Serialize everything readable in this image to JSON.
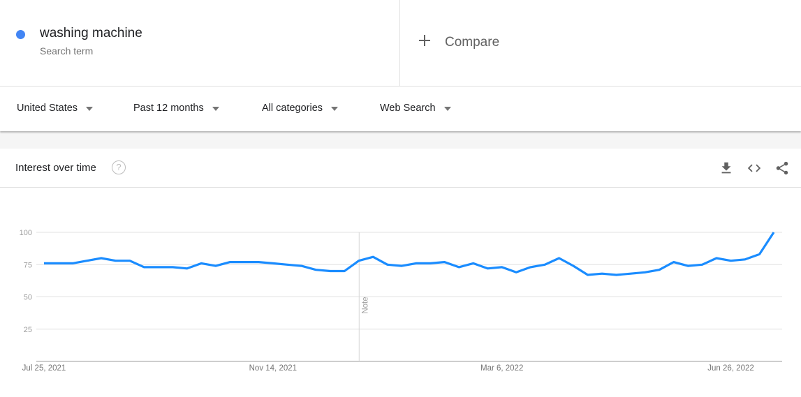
{
  "search_term": {
    "name": "washing machine",
    "type_label": "Search term",
    "color": "#4285f4"
  },
  "compare": {
    "icon": "plus-icon",
    "label": "Compare"
  },
  "filters": [
    {
      "label": "United States",
      "icon": "caret-down-icon"
    },
    {
      "label": "Past 12 months",
      "icon": "caret-down-icon"
    },
    {
      "label": "All categories",
      "icon": "caret-down-icon"
    },
    {
      "label": "Web Search",
      "icon": "caret-down-icon"
    }
  ],
  "card": {
    "title": "Interest over time",
    "help_icon": "help-circle-icon",
    "help_glyph": "?",
    "actions": [
      {
        "name": "download-icon"
      },
      {
        "name": "embed-code-icon"
      },
      {
        "name": "share-icon"
      }
    ]
  },
  "chart_data": {
    "type": "line",
    "title": "Interest over time",
    "xlabel": "",
    "ylabel": "",
    "ylim": [
      0,
      100
    ],
    "yticks": [
      25,
      50,
      75,
      100
    ],
    "grid": true,
    "x_tick_labels": [
      {
        "label": "Jul 25, 2021",
        "index": 0
      },
      {
        "label": "Nov 14, 2021",
        "index": 16
      },
      {
        "label": "Mar 6, 2022",
        "index": 32
      },
      {
        "label": "Jun 26, 2022",
        "index": 48
      }
    ],
    "annotations": [
      {
        "label": "Note",
        "index": 22
      }
    ],
    "series": [
      {
        "name": "washing machine",
        "color": "#1a8cff",
        "values": [
          76,
          76,
          76,
          78,
          80,
          78,
          78,
          73,
          73,
          73,
          72,
          76,
          74,
          77,
          77,
          77,
          76,
          75,
          74,
          71,
          70,
          70,
          78,
          81,
          75,
          74,
          76,
          76,
          77,
          73,
          76,
          72,
          73,
          69,
          73,
          75,
          80,
          74,
          67,
          68,
          67,
          68,
          69,
          71,
          77,
          74,
          75,
          80,
          78,
          79,
          83,
          100
        ]
      }
    ]
  }
}
